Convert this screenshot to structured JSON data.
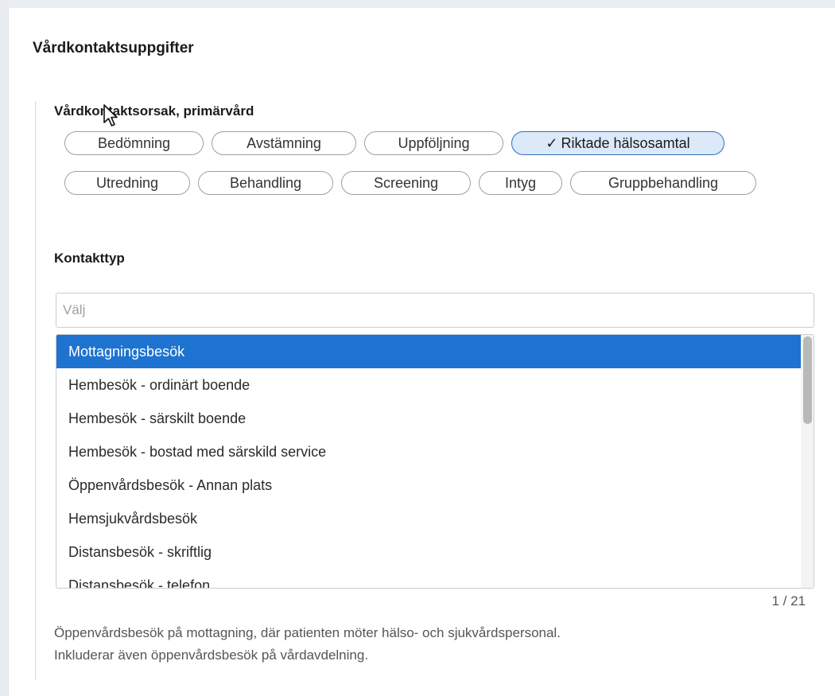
{
  "section": {
    "title": "Vårdkontaktsuppgifter"
  },
  "reason": {
    "label": "Vårdkontaktsorsak, primärvård",
    "selected_check": "✓",
    "row1": [
      {
        "label": "Bedömning",
        "selected": false
      },
      {
        "label": "Avstämning",
        "selected": false
      },
      {
        "label": "Uppföljning",
        "selected": false
      },
      {
        "label": "Riktade hälsosamtal",
        "selected": true
      }
    ],
    "row2": [
      {
        "label": "Utredning",
        "selected": false
      },
      {
        "label": "Behandling",
        "selected": false
      },
      {
        "label": "Screening",
        "selected": false
      },
      {
        "label": "Intyg",
        "selected": false
      },
      {
        "label": "Gruppbehandling",
        "selected": false
      }
    ]
  },
  "contact_type": {
    "label": "Kontakttyp",
    "placeholder": "Välj",
    "value": "",
    "options": [
      "Mottagningsbesök",
      "Hembesök - ordinärt boende",
      "Hembesök - särskilt boende",
      "Hembesök - bostad med särskild service",
      "Öppenvårdsbesök - Annan plats",
      "Hemsjukvårdsbesök",
      "Distansbesök - skriftlig",
      "Distansbesök - telefon"
    ],
    "active_index": 0,
    "counter": "1 / 21",
    "description_line1": "Öppenvårdsbesök på mottagning, där  patienten möter  hälso- och sjukvårdspersonal.",
    "description_line2": "Inkluderar även öppenvårdsbesök på  vårdavdelning."
  },
  "colors": {
    "accent": "#1f73d0",
    "selected_chip_bg": "#dce9f8"
  },
  "icons": {
    "check": "check-icon",
    "cursor": "mouse-pointer-icon"
  }
}
